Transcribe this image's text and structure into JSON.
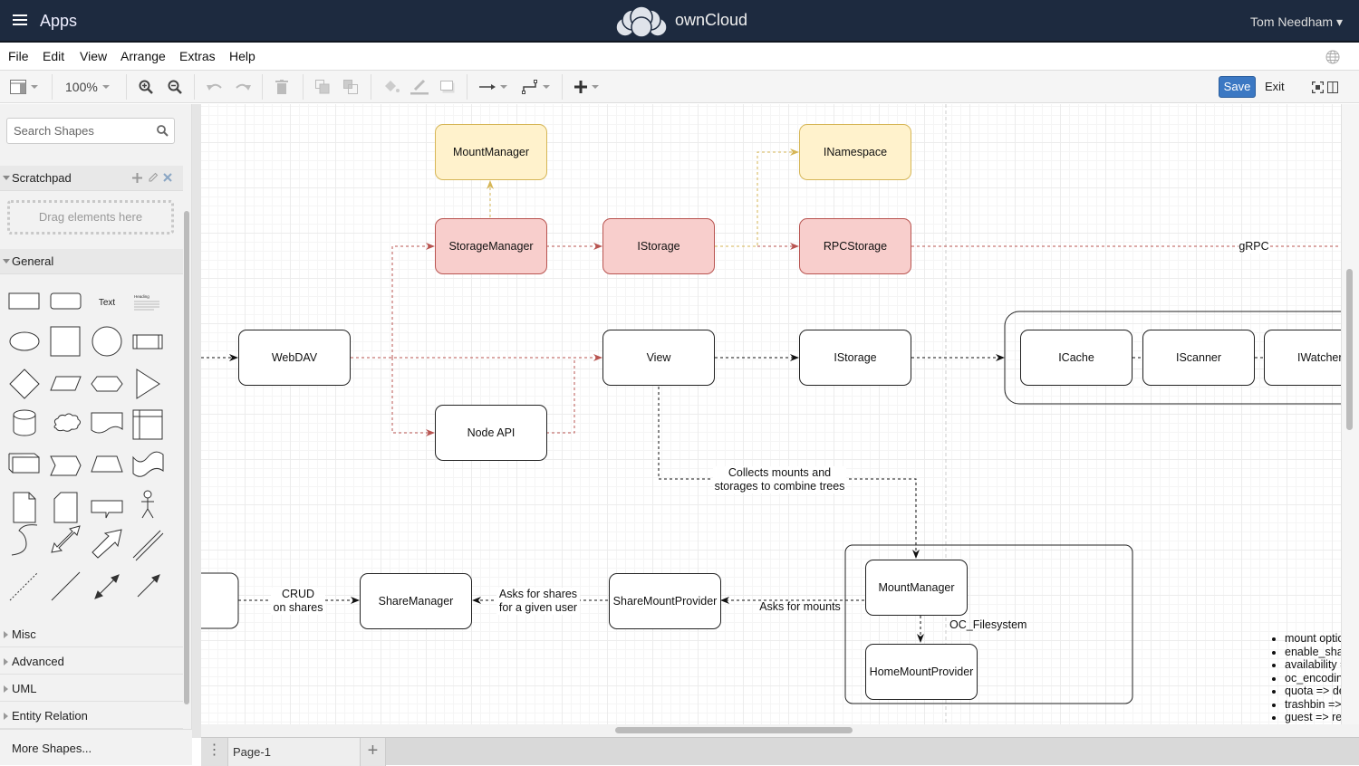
{
  "topbar": {
    "apps_label": "Apps",
    "brand": "ownCloud",
    "user": "Tom Needham ▾"
  },
  "menubar": {
    "items": [
      "File",
      "Edit",
      "View",
      "Arrange",
      "Extras",
      "Help"
    ]
  },
  "toolbar": {
    "zoom_level": "100%",
    "save_label": "Save",
    "exit_label": "Exit"
  },
  "sidebar": {
    "search_placeholder": "Search Shapes",
    "scratchpad_title": "Scratchpad",
    "scratchpad_hint": "Drag elements here",
    "general_title": "General",
    "text_shape_label": "Text",
    "heading_shape_label": "Heading",
    "collapsed_sections": [
      "Misc",
      "Advanced",
      "UML",
      "Entity Relation"
    ],
    "more_shapes": "More Shapes..."
  },
  "diagram": {
    "nodes": {
      "mountmanager_top": "MountManager",
      "inamespace": "INamespace",
      "storagemanager": "StorageManager",
      "istorage_top": "IStorage",
      "rpcstorage": "RPCStorage",
      "webdav": "WebDAV",
      "view": "View",
      "istorage_mid": "IStorage",
      "icache": "ICache",
      "iscanner": "IScanner",
      "iwatcher": "IWatcher",
      "nodeapi": "Node API",
      "sharemanager": "ShareManager",
      "sharemountprovider": "ShareMountProvider",
      "mountmanager_bottom": "MountManager",
      "homemountprovider": "HomeMountProvider"
    },
    "labels": {
      "grpc": "gRPC",
      "collects_1": "Collects mounts and",
      "collects_2": "storages to combine trees",
      "crud_1": "CRUD",
      "crud_2": "on shares",
      "asks_shares_1": "Asks for shares",
      "asks_shares_2": "for a given user",
      "asks_mounts": "Asks for mounts",
      "oc_filesystem": "OC_Filesystem"
    },
    "bullets": [
      "mount options",
      "enable_sharing",
      "availability =>",
      "oc_encoding",
      "quota => default",
      "trashbin =>",
      "guest => read"
    ],
    "colors": {
      "yellow_fill": "#fff2cc",
      "yellow_stroke": "#d6b656",
      "red_fill": "#f8cecc",
      "red_stroke": "#b85450"
    }
  },
  "pages": {
    "current": "Page-1"
  }
}
